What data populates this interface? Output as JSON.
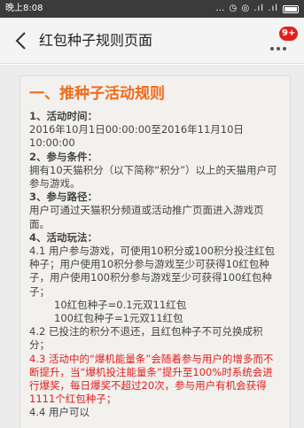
{
  "status_bar": {
    "time": "晚上8:08",
    "icons": "… ◷ ◎ .ıl .ıl"
  },
  "nav": {
    "title": "红包种子规则页面",
    "badge": "9+"
  },
  "colors": {
    "accent": "#f06b1d",
    "highlight": "#e0201f",
    "nav_bg": "#f4f4f4"
  },
  "rules": {
    "title": "一、推种子活动规则",
    "lines": [
      {
        "type": "h",
        "text": "1、活动时间："
      },
      {
        "type": "p",
        "text": "2016年10月1日00:00:00至2016年11月10日10:00:00"
      },
      {
        "type": "h",
        "text": "2、参与条件："
      },
      {
        "type": "p",
        "text": "拥有10天猫积分（以下简称“积分”）以上的天猫用户可参与游戏。"
      },
      {
        "type": "h",
        "text": "3、参与路径："
      },
      {
        "type": "p",
        "text": "用户可通过天猫积分频道或活动推广页面进入游戏页面。"
      },
      {
        "type": "h",
        "text": "4、活动玩法："
      },
      {
        "type": "p",
        "text": "4.1 用户参与游戏，可使用10积分或100积分投注红包种子；用户使用10积分参与游戏至少可获得10红包种子，用户使用100积分参与游戏至少可获得100红包种子；"
      },
      {
        "type": "ind",
        "text": "10红包种子=0.1元双11红包"
      },
      {
        "type": "ind",
        "text": "100红包种子=1元双11红包"
      },
      {
        "type": "p",
        "text": "4.2 已投注的积分不退还，且红包种子不可兑换成积分；"
      },
      {
        "type": "red",
        "text": "4.3 活动中的“爆机能量条”会随着参与用户的增多而不断提升，当“爆机投注能量条”提升至100%时系统会进行爆奖，每日爆奖不超过20次，参与用户有机会获得1111个红包种子；"
      },
      {
        "type": "p",
        "text": "4.4 用户可以"
      }
    ]
  }
}
